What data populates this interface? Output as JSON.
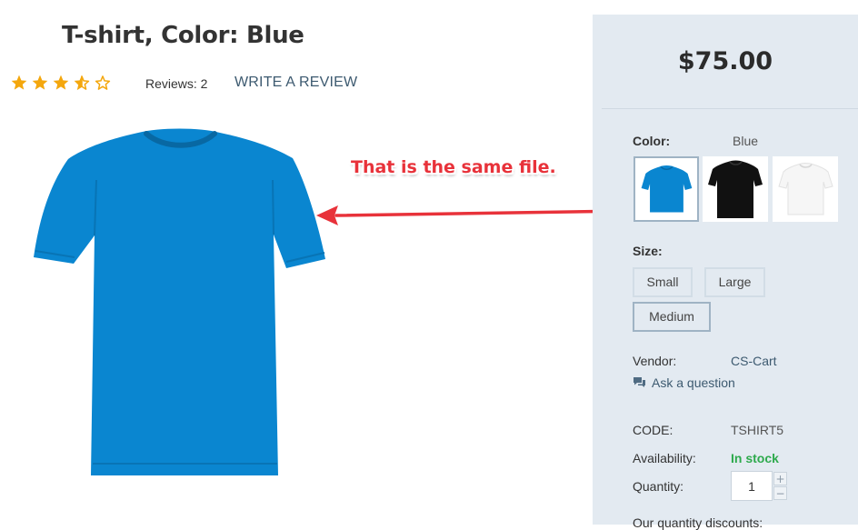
{
  "product": {
    "title": "T-shirt, Color: Blue",
    "rating": 3.5,
    "rating_max": 5,
    "reviews_text": "Reviews: 2",
    "write_review_label": "WRITE A REVIEW",
    "image_color": "#0a86d0",
    "icons": {
      "star_full": "star-full-icon",
      "star_half": "star-half-icon",
      "star_empty": "star-empty-icon"
    }
  },
  "annotation": {
    "text": "That is the same file.",
    "color": "#e8323a"
  },
  "panel": {
    "price": "$75.00",
    "color_label": "Color:",
    "color_value": "Blue",
    "swatches": [
      {
        "name": "Blue",
        "color": "#0a86d0",
        "selected": true
      },
      {
        "name": "Black",
        "color": "#111111",
        "selected": false
      },
      {
        "name": "White",
        "color": "#f6f6f6",
        "selected": false
      }
    ],
    "size_label": "Size:",
    "sizes": [
      {
        "label": "Small",
        "selected": false
      },
      {
        "label": "Large",
        "selected": false
      },
      {
        "label": "Medium",
        "selected": true
      }
    ],
    "vendor_label": "Vendor:",
    "vendor_value": "CS-Cart",
    "ask_question": "Ask a question",
    "code_label": "CODE:",
    "code_value": "TSHIRT5",
    "availability_label": "Availability:",
    "availability_value": "In stock",
    "quantity_label": "Quantity:",
    "quantity_value": "1",
    "qty_plus": "+",
    "qty_minus": "−",
    "discounts_label": "Our quantity discounts:",
    "accent_colors": {
      "link": "#3d5a70",
      "in_stock": "#2eaa4d",
      "star": "#f4a70d",
      "panel_bg": "#e3eaf1"
    }
  }
}
